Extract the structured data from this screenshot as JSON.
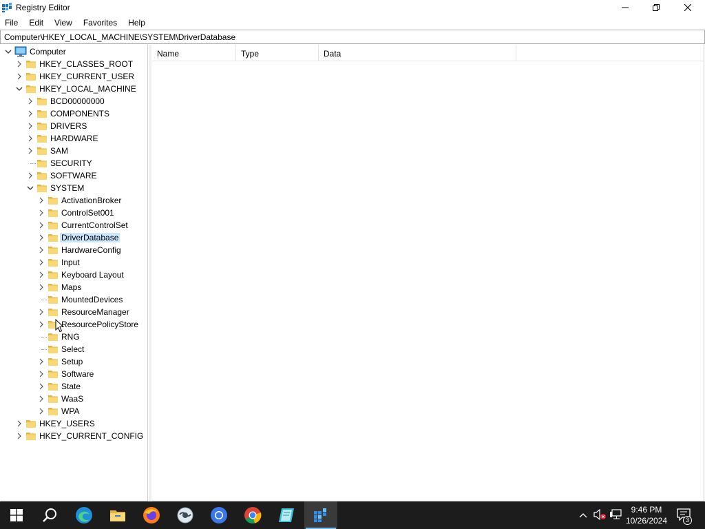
{
  "window": {
    "title": "Registry Editor",
    "icon": "regedit-icon",
    "controls": {
      "minimize": "minimize-icon",
      "maximize": "restore-icon",
      "close": "close-icon"
    }
  },
  "menu": {
    "items": [
      {
        "label": "File"
      },
      {
        "label": "Edit"
      },
      {
        "label": "View"
      },
      {
        "label": "Favorites"
      },
      {
        "label": "Help"
      }
    ]
  },
  "address": {
    "path": "Computer\\HKEY_LOCAL_MACHINE\\SYSTEM\\DriverDatabase"
  },
  "tree": {
    "root": "Computer",
    "hives": [
      {
        "label": "HKEY_CLASSES_ROOT",
        "state": "collapsed"
      },
      {
        "label": "HKEY_CURRENT_USER",
        "state": "collapsed"
      },
      {
        "label": "HKEY_LOCAL_MACHINE",
        "state": "expanded"
      },
      {
        "label": "HKEY_USERS",
        "state": "collapsed"
      },
      {
        "label": "HKEY_CURRENT_CONFIG",
        "state": "collapsed"
      }
    ],
    "hklm_children": [
      {
        "label": "BCD00000000",
        "state": "collapsed"
      },
      {
        "label": "COMPONENTS",
        "state": "collapsed"
      },
      {
        "label": "DRIVERS",
        "state": "collapsed"
      },
      {
        "label": "HARDWARE",
        "state": "collapsed"
      },
      {
        "label": "SAM",
        "state": "collapsed"
      },
      {
        "label": "SECURITY",
        "state": "leaf"
      },
      {
        "label": "SOFTWARE",
        "state": "collapsed"
      },
      {
        "label": "SYSTEM",
        "state": "expanded"
      }
    ],
    "system_children": [
      {
        "label": "ActivationBroker",
        "state": "collapsed"
      },
      {
        "label": "ControlSet001",
        "state": "collapsed"
      },
      {
        "label": "CurrentControlSet",
        "state": "collapsed"
      },
      {
        "label": "DriverDatabase",
        "state": "collapsed",
        "selected": true
      },
      {
        "label": "HardwareConfig",
        "state": "collapsed"
      },
      {
        "label": "Input",
        "state": "collapsed"
      },
      {
        "label": "Keyboard Layout",
        "state": "collapsed"
      },
      {
        "label": "Maps",
        "state": "collapsed"
      },
      {
        "label": "MountedDevices",
        "state": "leaf"
      },
      {
        "label": "ResourceManager",
        "state": "collapsed"
      },
      {
        "label": "ResourcePolicyStore",
        "state": "collapsed"
      },
      {
        "label": "RNG",
        "state": "leaf"
      },
      {
        "label": "Select",
        "state": "leaf"
      },
      {
        "label": "Setup",
        "state": "collapsed"
      },
      {
        "label": "Software",
        "state": "collapsed"
      },
      {
        "label": "State",
        "state": "collapsed"
      },
      {
        "label": "WaaS",
        "state": "collapsed"
      },
      {
        "label": "WPA",
        "state": "collapsed"
      }
    ]
  },
  "list": {
    "columns": [
      {
        "label": "Name"
      },
      {
        "label": "Type"
      },
      {
        "label": "Data"
      }
    ],
    "rows": []
  },
  "taskbar": {
    "apps": [
      {
        "name": "start-button",
        "icon": "windows-logo-icon"
      },
      {
        "name": "search-button",
        "icon": "search-icon"
      },
      {
        "name": "edge-button",
        "icon": "edge-icon"
      },
      {
        "name": "file-explorer-button",
        "icon": "folder-icon"
      },
      {
        "name": "firefox-button",
        "icon": "firefox-icon"
      },
      {
        "name": "app-globe-button",
        "icon": "globe-icon"
      },
      {
        "name": "chromium-button",
        "icon": "chromium-icon"
      },
      {
        "name": "chrome-button",
        "icon": "chrome-icon"
      },
      {
        "name": "notepad-button",
        "icon": "notepad-icon"
      },
      {
        "name": "regedit-button",
        "icon": "regedit-icon",
        "active": true
      }
    ],
    "tray": {
      "time": "9:46 PM",
      "date": "10/26/2024",
      "notifications": "3"
    }
  },
  "colors": {
    "selection": "#cce8ff",
    "taskbar": "#1c1c1c",
    "accent": "#76b9ed",
    "folder": "#f8d775"
  }
}
